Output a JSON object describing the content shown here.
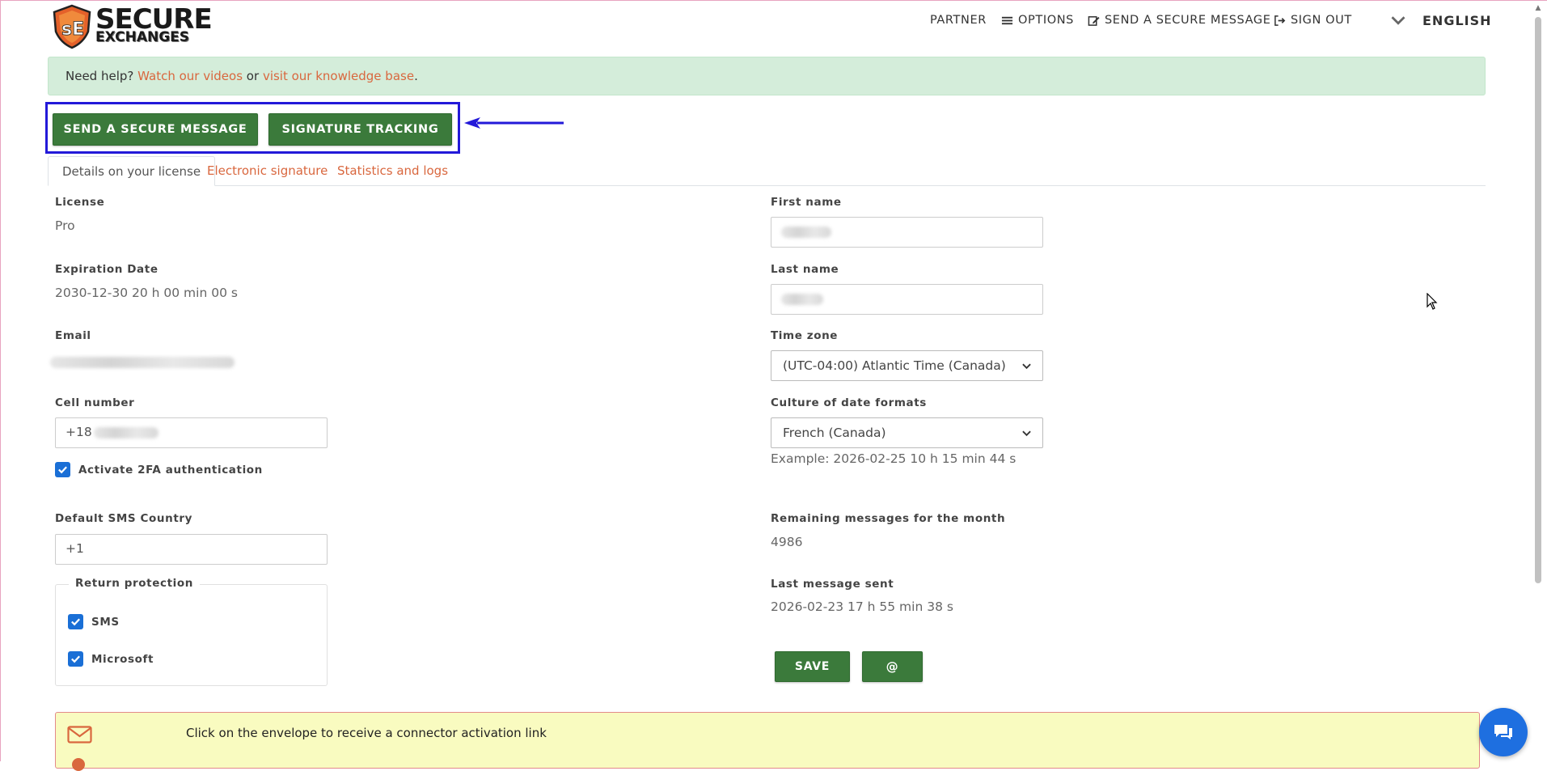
{
  "header": {
    "logo": {
      "line1": "SECURE",
      "line2": "EXCHANGES"
    },
    "nav": {
      "partner": "PARTNER",
      "options": "OPTIONS",
      "send_message": "SEND A SECURE MESSAGE",
      "sign_out": "SIGN OUT",
      "language": "ENGLISH"
    }
  },
  "help": {
    "prefix": "Need help?",
    "videos_link": "Watch our videos",
    "or": "or",
    "kb_link": "visit our knowledge base",
    "suffix": "."
  },
  "actions": {
    "send_secure": "SEND A SECURE MESSAGE",
    "signature_tracking": "SIGNATURE TRACKING"
  },
  "tabs": [
    "Details on your license",
    "Electronic signature",
    "Statistics and logs"
  ],
  "left": {
    "license_label": "License",
    "license_value": "Pro",
    "expiration_label": "Expiration Date",
    "expiration_value": "2030-12-30 20 h 00 min 00 s",
    "email_label": "Email",
    "cell_label": "Cell number",
    "cell_value": "+18",
    "twofa_label": "Activate 2FA authentication",
    "sms_country_label": "Default SMS Country",
    "sms_country_value": "+1",
    "return_protection_label": "Return protection",
    "return_sms": "SMS",
    "return_microsoft": "Microsoft"
  },
  "right": {
    "first_name_label": "First name",
    "last_name_label": "Last name",
    "timezone_label": "Time zone",
    "timezone_value": "(UTC-04:00) Atlantic Time (Canada)",
    "culture_label": "Culture of date formats",
    "culture_value": "French (Canada)",
    "culture_example": "Example: 2026-02-25 10 h 15 min 44 s",
    "remaining_label": "Remaining messages for the month",
    "remaining_value": "4986",
    "last_sent_label": "Last message sent",
    "last_sent_value": "2026-02-23 17 h 55 min 38 s",
    "save_button": "SAVE",
    "at_button": "@"
  },
  "connector": {
    "text": "Click on the envelope to receive a connector activation link"
  },
  "colors": {
    "green": "#3b7a3b",
    "link": "#d9673e",
    "banner": "#d4edda",
    "highlight": "#2319d9",
    "checkbox": "#1a6fd6",
    "chat": "#1e6fe0"
  }
}
